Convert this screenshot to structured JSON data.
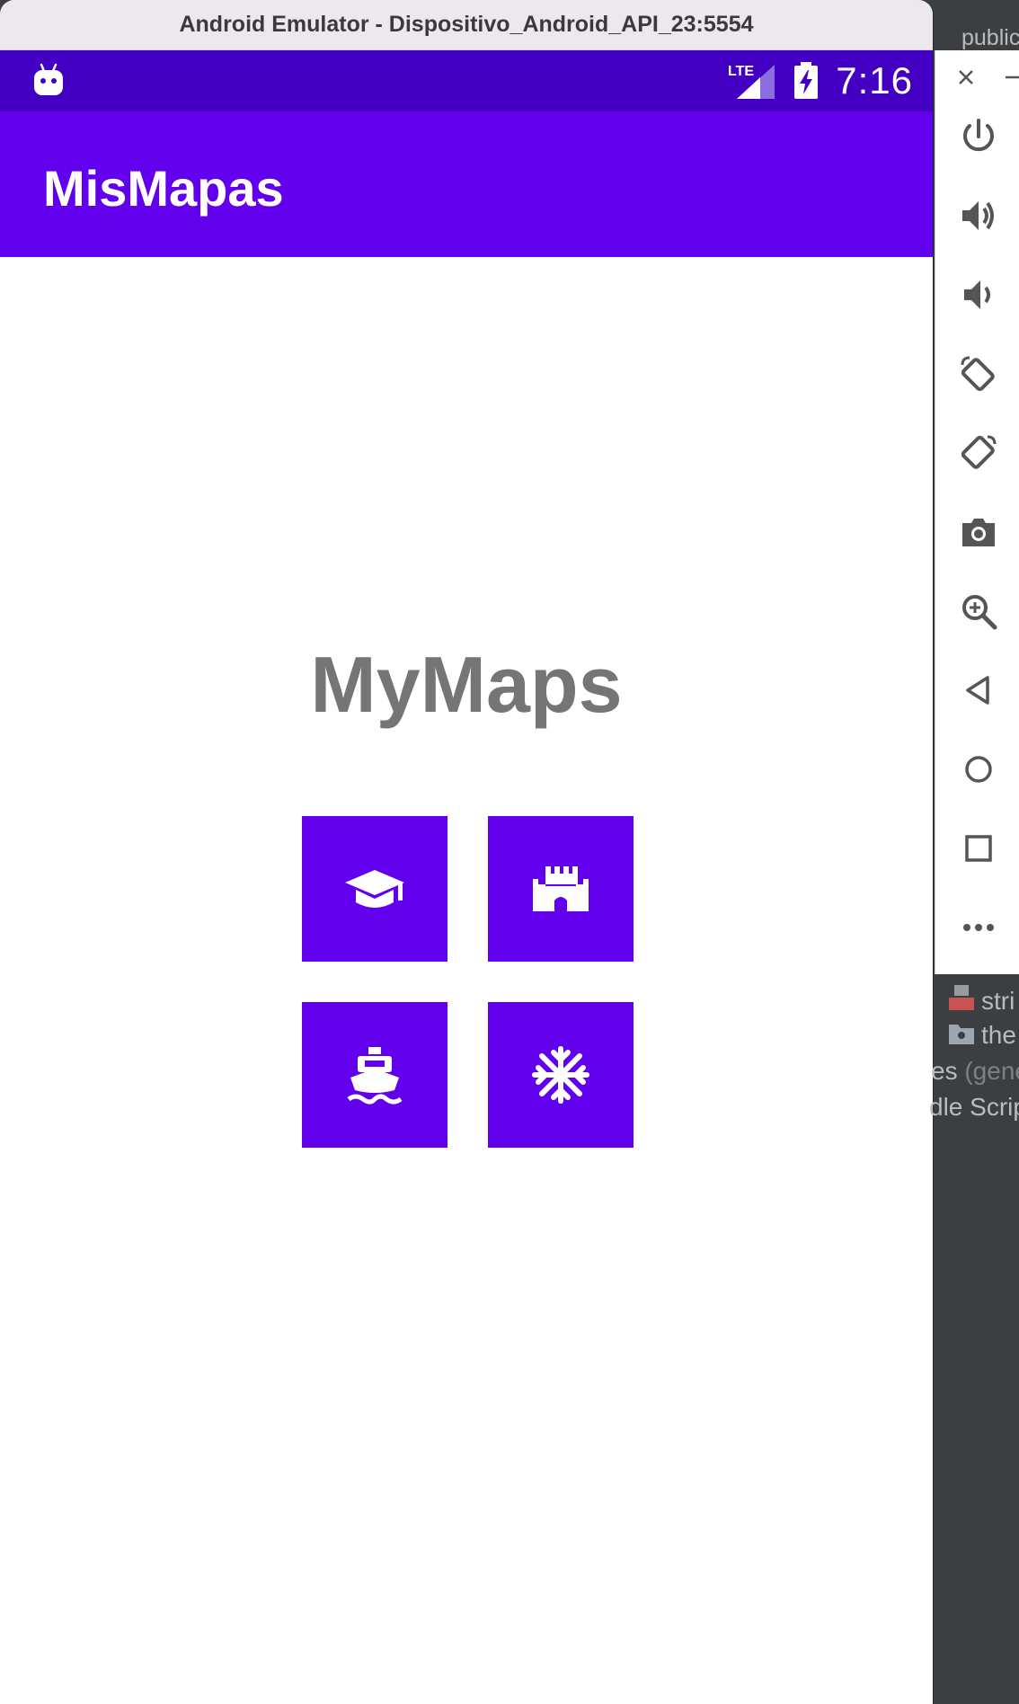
{
  "window": {
    "title": "Android Emulator - Dispositivo_Android_API_23:5554"
  },
  "status_bar": {
    "time": "7:16",
    "network_label": "LTE",
    "icons": [
      "android-debug-icon",
      "lte-signal-icon",
      "battery-charging-icon"
    ]
  },
  "app_bar": {
    "title": "MisMapas"
  },
  "main": {
    "heading": "MyMaps",
    "tiles": [
      {
        "icon": "school-icon"
      },
      {
        "icon": "castle-icon"
      },
      {
        "icon": "ferry-icon"
      },
      {
        "icon": "snowflake-icon"
      }
    ]
  },
  "emulator_toolbar": {
    "items": [
      "close-icon",
      "minimize-icon",
      "power-icon",
      "volume-up-icon",
      "volume-down-icon",
      "rotate-left-icon",
      "rotate-right-icon",
      "camera-icon",
      "zoom-icon",
      "back-icon",
      "home-icon",
      "overview-icon",
      "more-icon"
    ]
  },
  "ide_background": {
    "breadcrumb": "public",
    "tree_items": [
      {
        "label": "stri"
      },
      {
        "label": "the"
      },
      {
        "label_prefix": "es",
        "label_suffix": "(gene"
      },
      {
        "label": "dle Scrip"
      }
    ]
  },
  "colors": {
    "primary": "#6200ee",
    "primary_dark": "#4400c2",
    "heading_text": "#757575",
    "ide_bg": "#3c3f41"
  }
}
